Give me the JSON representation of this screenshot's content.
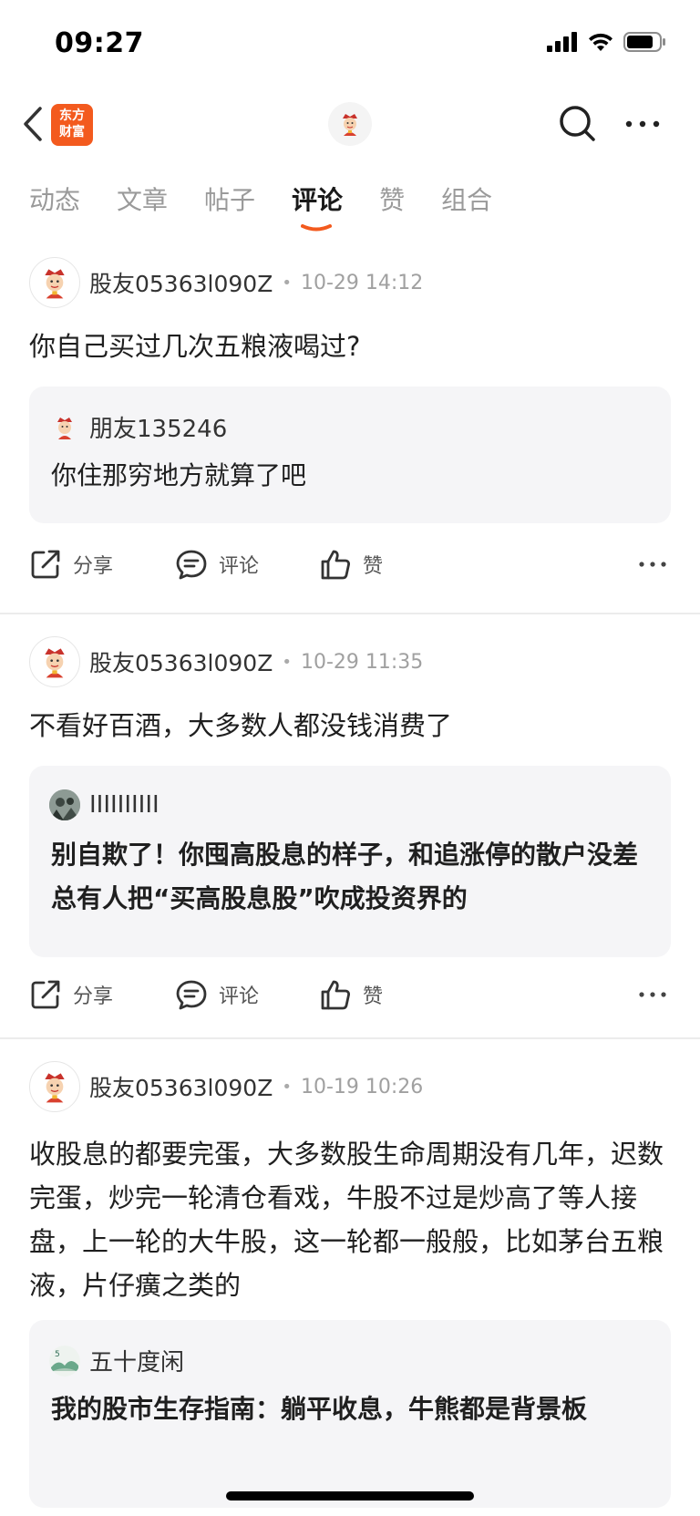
{
  "status_bar": {
    "time": "09:27"
  },
  "nav": {
    "logo_line1": "东方",
    "logo_line2": "财富"
  },
  "tabs": [
    {
      "label": "动态"
    },
    {
      "label": "文章"
    },
    {
      "label": "帖子"
    },
    {
      "label": "评论",
      "active": true
    },
    {
      "label": "赞"
    },
    {
      "label": "组合"
    }
  ],
  "colors": {
    "accent": "#f35a1e",
    "quote_bg": "#f5f5f7",
    "muted": "#9a9a9a"
  },
  "posts": [
    {
      "username": "股友05363l090Z",
      "time": "10-29 14:12",
      "text": "你自己买过几次五粮液喝过?",
      "quote": {
        "username": "朋友135246",
        "text": "你住那穷地方就算了吧"
      }
    },
    {
      "username": "股友05363l090Z",
      "time": "10-29 11:35",
      "text": "不看好百酒，大多数人都没钱消费了",
      "quote": {
        "username": "IIIIIIIIII",
        "text": "别自欺了！你囤高股息的样子，和追涨停的散户没差总有人把“买高股息股”吹成投资界的"
      }
    },
    {
      "username": "股友05363l090Z",
      "time": "10-19 10:26",
      "text": "收股息的都要完蛋，大多数股生命周期没有几年，迟数完蛋，炒完一轮清仓看戏，牛股不过是炒高了等人接盘，上一轮的大牛股，这一轮都一般般，比如茅台五粮液，片仔癀之类的",
      "quote": {
        "username": "五十度闲",
        "text": "我的股市生存指南：躺平收息，牛熊都是背景板"
      }
    }
  ],
  "actions": {
    "share": "分享",
    "comment": "评论",
    "like": "赞"
  }
}
